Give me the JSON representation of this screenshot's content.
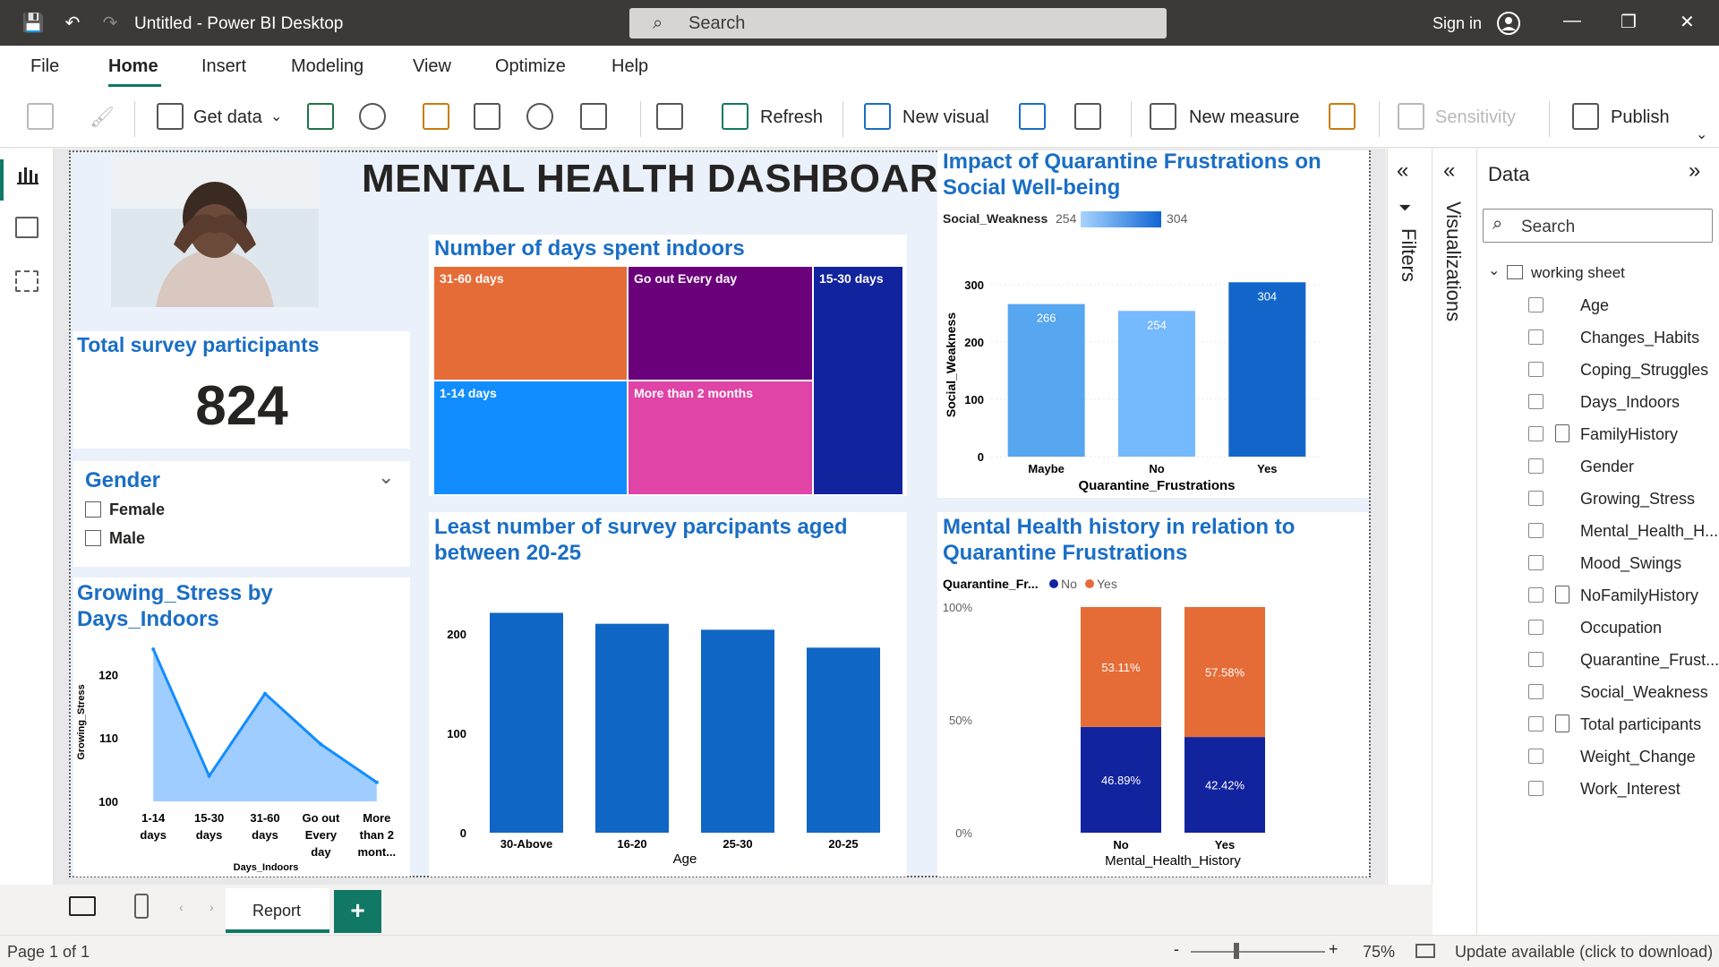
{
  "window": {
    "title": "Untitled - Power BI Desktop",
    "search_placeholder": "Search",
    "sign_in": "Sign in"
  },
  "menu": {
    "items": [
      "File",
      "Home",
      "Insert",
      "Modeling",
      "View",
      "Optimize",
      "Help"
    ],
    "active": "Home"
  },
  "ribbon": {
    "get_data": "Get data",
    "refresh": "Refresh",
    "new_visual": "New visual",
    "new_measure": "New measure",
    "sensitivity": "Sensitivity",
    "publish": "Publish"
  },
  "dashboard": {
    "title": "MENTAL HEALTH DASHBOARD",
    "kpi": {
      "label": "Total survey participants",
      "value": "824"
    },
    "slicer": {
      "title": "Gender",
      "options": [
        "Female",
        "Male"
      ]
    }
  },
  "colors": {
    "accent": "#117865",
    "title_blue": "#1a6ec5"
  },
  "chart_data": [
    {
      "type": "treemap",
      "title": "Number of days spent indoors",
      "categories": [
        "31-60 days",
        "Go out Every day",
        "15-30 days",
        "1-14 days",
        "More than 2 months"
      ],
      "colors": [
        "#e66c37",
        "#6b007b",
        "#12239e",
        "#118dff",
        "#e044a7"
      ]
    },
    {
      "type": "bar",
      "title": "Impact of Quarantine Frustrations on Social Well-being",
      "legend_title": "Social_Weakness",
      "legend_min": "254",
      "legend_max": "304",
      "categories": [
        "Maybe",
        "No",
        "Yes"
      ],
      "values": [
        266,
        254,
        304
      ],
      "xlabel": "Quarantine_Frustrations",
      "ylabel": "Social_Weakness",
      "yticks": [
        "0",
        "100",
        "200",
        "300"
      ],
      "ylim": [
        0,
        320
      ]
    },
    {
      "type": "area",
      "title": "Growing_Stress by Days_Indoors",
      "categories": [
        "1-14 days",
        "15-30 days",
        "31-60 days",
        "Go out Every day",
        "More than 2 mont..."
      ],
      "category_lines": [
        [
          "1-14",
          "days"
        ],
        [
          "15-30",
          "days"
        ],
        [
          "31-60",
          "days"
        ],
        [
          "Go out",
          "Every",
          "day"
        ],
        [
          "More",
          "than 2",
          "mont..."
        ]
      ],
      "values": [
        124,
        104,
        117,
        109,
        103
      ],
      "xlabel": "Days_Indoors",
      "ylabel": "Growing_Stress",
      "yticks": [
        "100",
        "110",
        "120"
      ],
      "ylim": [
        100,
        125
      ]
    },
    {
      "type": "bar",
      "title": "Least number of survey parcipants aged between 20-25",
      "categories": [
        "30-Above",
        "16-20",
        "25-30",
        "20-25"
      ],
      "values": [
        221,
        210,
        204,
        186
      ],
      "xlabel": "Age",
      "yticks": [
        "0",
        "100",
        "200"
      ],
      "ylim": [
        0,
        225
      ]
    },
    {
      "type": "bar",
      "stacked": "100%",
      "title": "Mental Health history in relation to Quarantine Frustrations",
      "legend_title": "Quarantine_Fr...",
      "categories": [
        "No",
        "Yes"
      ],
      "series": [
        {
          "name": "No",
          "values": [
            46.89,
            42.42
          ],
          "labels": [
            "46.89%",
            "42.42%"
          ],
          "color": "#12239e"
        },
        {
          "name": "Yes",
          "values": [
            53.11,
            57.58
          ],
          "labels": [
            "53.11%",
            "57.58%"
          ],
          "color": "#e66c37"
        }
      ],
      "xlabel": "Mental_Health_History",
      "yticks": [
        "0%",
        "50%",
        "100%"
      ],
      "ylim": [
        0,
        100
      ]
    }
  ],
  "panes": {
    "filters": "Filters",
    "visualizations": "Visualizations",
    "data": "Data",
    "data_search": "Search",
    "table_name": "working sheet",
    "fields": [
      "Age",
      "Changes_Habits",
      "Coping_Struggles",
      "Days_Indoors",
      "FamilyHistory",
      "Gender",
      "Growing_Stress",
      "Mental_Health_H...",
      "Mood_Swings",
      "NoFamilyHistory",
      "Occupation",
      "Quarantine_Frust...",
      "Social_Weakness",
      "Total participants",
      "Weight_Change",
      "Work_Interest"
    ],
    "calc_fields": [
      "FamilyHistory",
      "NoFamilyHistory",
      "Total participants"
    ]
  },
  "tabs": {
    "report": "Report"
  },
  "status": {
    "page": "Page 1 of 1",
    "zoom": "75%",
    "update": "Update available (click to download)"
  }
}
